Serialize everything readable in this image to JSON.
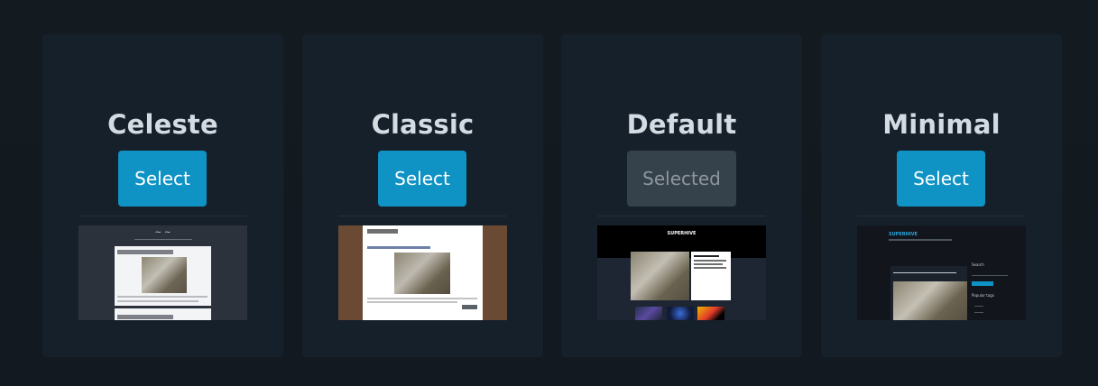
{
  "themes": [
    {
      "name": "Celeste",
      "button": "Select",
      "state": "select"
    },
    {
      "name": "Classic",
      "button": "Select",
      "state": "select"
    },
    {
      "name": "Default",
      "button": "Selected",
      "state": "selected"
    },
    {
      "name": "Minimal",
      "button": "Select",
      "state": "select"
    }
  ],
  "colors": {
    "page_background": "#131a20",
    "card_background": "#16202a",
    "title_text": "#d4dbe2",
    "select_button": "#0f93c4",
    "selected_button": "#35414b",
    "selected_button_text": "#8e979e"
  },
  "thumbnails": {
    "default_brand": "SUPERHIVE",
    "minimal_brand": "SUPERHIVE",
    "minimal_search": "Search",
    "minimal_popular_tags": "Popular tags"
  }
}
